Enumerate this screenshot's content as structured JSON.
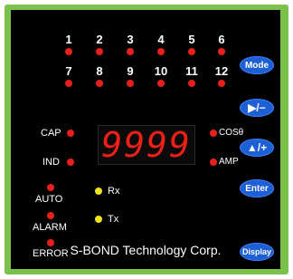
{
  "top_numbers": [
    "1",
    "2",
    "3",
    "4",
    "5",
    "6"
  ],
  "bottom_numbers": [
    "7",
    "8",
    "9",
    "10",
    "11",
    "12"
  ],
  "labels": {
    "cap": "CAP",
    "ind": "IND",
    "cos": "COSθ",
    "amp": "AMP",
    "rx": "Rx",
    "tx": "Tx",
    "auto": "AUTO",
    "alarm": "ALARM",
    "error": "ERROR"
  },
  "display": {
    "value": "9999"
  },
  "buttons": {
    "mode": "Mode",
    "play_minus": "▶/−",
    "up_plus": "▲/+",
    "enter": "Enter",
    "display": "Display"
  },
  "footer": "S-BOND Technology Corp.",
  "colors": {
    "panel": "#000000",
    "frame": "#7cc14a",
    "led_red": "#e8201a",
    "led_yellow": "#f2e21a",
    "button_blue": "#1d5fd6",
    "digit_red": "#ee2018"
  }
}
